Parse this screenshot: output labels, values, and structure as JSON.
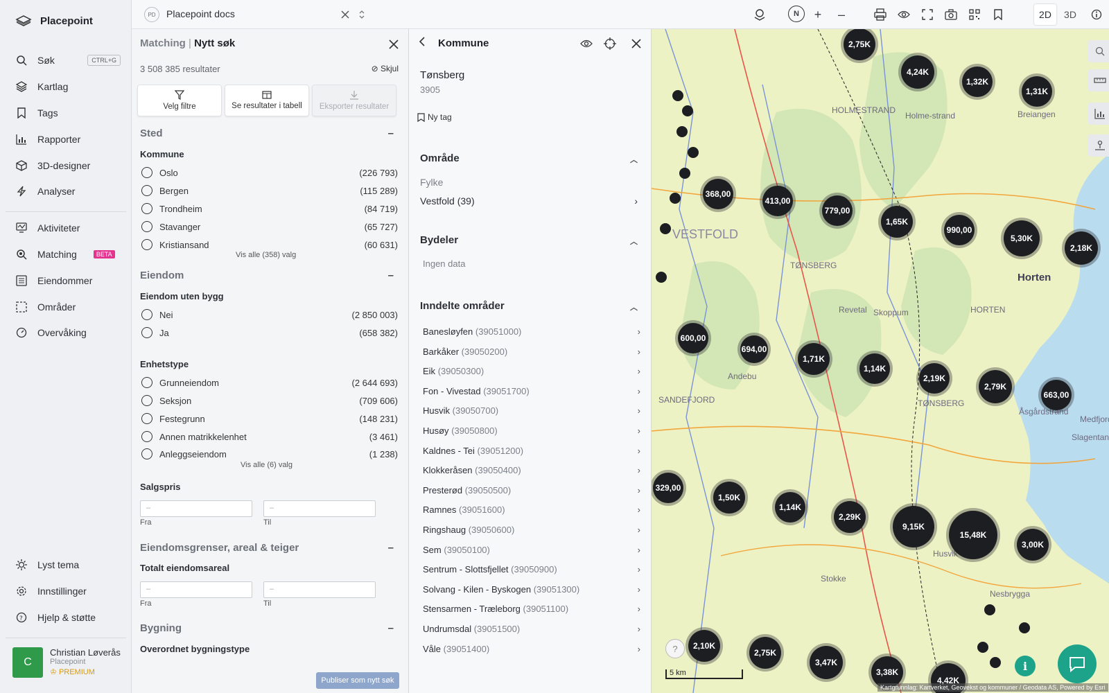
{
  "app": {
    "brand": "Placepoint"
  },
  "nav": {
    "items": [
      {
        "label": "Søk",
        "kbd": "CTRL+G"
      },
      {
        "label": "Kartlag"
      },
      {
        "label": "Tags"
      },
      {
        "label": "Rapporter"
      },
      {
        "label": "3D-designer"
      },
      {
        "label": "Analyser"
      },
      {
        "label": "Aktiviteter"
      },
      {
        "label": "Matching",
        "badge": "BETA"
      },
      {
        "label": "Eiendommer"
      },
      {
        "label": "Områder"
      },
      {
        "label": "Overvåking"
      }
    ],
    "bottom": [
      {
        "label": "Lyst tema"
      },
      {
        "label": "Innstillinger"
      },
      {
        "label": "Hjelp & støtte"
      }
    ],
    "user": {
      "initial": "C",
      "name": "Christian Løverås",
      "org": "Placepoint",
      "tier": "PREMIUM"
    }
  },
  "topbar": {
    "doc_badge": "PD",
    "doc_title": "Placepoint docs",
    "view_2d": "2D",
    "view_3d": "3D",
    "compass": "N"
  },
  "matching": {
    "crumb": "Matching",
    "sep": "|",
    "title": "Nytt søk",
    "result_count": "3 508 385 resultater",
    "hide_label": "Skjul",
    "buttons": {
      "filter": "Velg filtre",
      "table": "Se resultater i tabell",
      "export": "Eksporter resultater"
    },
    "sections": {
      "sted": "Sted",
      "kommune_label": "Kommune",
      "kommune_opts": [
        {
          "label": "Oslo",
          "count": "(226 793)"
        },
        {
          "label": "Bergen",
          "count": "(115 289)"
        },
        {
          "label": "Trondheim",
          "count": "(84 719)"
        },
        {
          "label": "Stavanger",
          "count": "(65 727)"
        },
        {
          "label": "Kristiansand",
          "count": "(60 631)"
        }
      ],
      "kommune_more": "Vis alle (358) valg",
      "eiendom": "Eiendom",
      "uten_bygg_label": "Eiendom uten bygg",
      "uten_bygg_opts": [
        {
          "label": "Nei",
          "count": "(2 850 003)"
        },
        {
          "label": "Ja",
          "count": "(658 382)"
        }
      ],
      "enhetstype_label": "Enhetstype",
      "enhetstype_opts": [
        {
          "label": "Grunneiendom",
          "count": "(2 644 693)"
        },
        {
          "label": "Seksjon",
          "count": "(709 606)"
        },
        {
          "label": "Festegrunn",
          "count": "(148 231)"
        },
        {
          "label": "Annen matrikkelenhet",
          "count": "(3 461)"
        },
        {
          "label": "Anleggseiendom",
          "count": "(1 238)"
        }
      ],
      "enhetstype_more": "Vis alle (6) valg",
      "salgspris_label": "Salgspris",
      "placeholder": "–",
      "from": "Fra",
      "to": "Til",
      "grenser": "Eiendomsgrenser, areal & teiger",
      "areal_label": "Totalt eiendomsareal",
      "bygning": "Bygning",
      "bygningstype_label": "Overordnet bygningstype"
    },
    "publish": "Publiser som nytt søk"
  },
  "kommune": {
    "title": "Kommune",
    "name": "Tønsberg",
    "number": "3905",
    "new_tag": "Ny tag",
    "omrade": "Område",
    "fylke_label": "Fylke",
    "fylke_value": "Vestfold (39)",
    "bydeler": "Bydeler",
    "no_data": "Ingen data",
    "inndelte": "Inndelte områder",
    "areas": [
      {
        "name": "Banesløyfen",
        "code": "(39051000)"
      },
      {
        "name": "Barkåker",
        "code": "(39050200)"
      },
      {
        "name": "Eik",
        "code": "(39050300)"
      },
      {
        "name": "Fon - Vivestad",
        "code": "(39051700)"
      },
      {
        "name": "Husvik",
        "code": "(39050700)"
      },
      {
        "name": "Husøy",
        "code": "(39050800)"
      },
      {
        "name": "Kaldnes - Tei",
        "code": "(39051200)"
      },
      {
        "name": "Klokkeråsen",
        "code": "(39050400)"
      },
      {
        "name": "Presterød",
        "code": "(39050500)"
      },
      {
        "name": "Ramnes",
        "code": "(39051600)"
      },
      {
        "name": "Ringshaug",
        "code": "(39050600)"
      },
      {
        "name": "Sem",
        "code": "(39050100)"
      },
      {
        "name": "Sentrum - Slottsfjellet",
        "code": "(39050900)"
      },
      {
        "name": "Solvang - Kilen - Byskogen",
        "code": "(39051300)"
      },
      {
        "name": "Stensarmen - Træleborg",
        "code": "(39051100)"
      },
      {
        "name": "Undrumsdal",
        "code": "(39051500)"
      },
      {
        "name": "Våle",
        "code": "(39051400)"
      }
    ]
  },
  "map": {
    "clusters": [
      {
        "label": "2,75K"
      },
      {
        "label": "4,24K"
      },
      {
        "label": "1,32K"
      },
      {
        "label": "1,31K"
      },
      {
        "label": "368,00"
      },
      {
        "label": "413,00"
      },
      {
        "label": "779,00"
      },
      {
        "label": "1,65K"
      },
      {
        "label": "990,00"
      },
      {
        "label": "5,30K"
      },
      {
        "label": "2,18K"
      },
      {
        "label": "600,00"
      },
      {
        "label": "694,00"
      },
      {
        "label": "1,71K"
      },
      {
        "label": "1,14K"
      },
      {
        "label": "2,19K"
      },
      {
        "label": "2,79K"
      },
      {
        "label": "663,00"
      },
      {
        "label": "329,00"
      },
      {
        "label": "1,50K"
      },
      {
        "label": "1,14K"
      },
      {
        "label": "2,29K"
      },
      {
        "label": "9,15K"
      },
      {
        "label": "15,48K"
      },
      {
        "label": "3,00K"
      },
      {
        "label": "2,10K"
      },
      {
        "label": "2,75K"
      },
      {
        "label": "3,47K"
      },
      {
        "label": "3,38K"
      },
      {
        "label": "4,42K"
      }
    ],
    "labels": [
      "HOLMESTRAND",
      "Holme-strand",
      "Breiangen",
      "VESTFOLD",
      "TØNSBERG",
      "Horten",
      "HORTEN",
      "Revetal",
      "Skoppum",
      "Andebu",
      "TØNSBERG",
      "Åsgårdstrand",
      "Medfjordbåen",
      "Slagentangen",
      "SANDEFJORD",
      "Stokke",
      "Nesbrygga",
      "Husvik"
    ],
    "scale": "5 km",
    "attribution": "Kartgrunnlag: Kartverket, Geovekst og kommuner / Geodata AS, Powered by Esri",
    "help": "?",
    "info": "i"
  }
}
